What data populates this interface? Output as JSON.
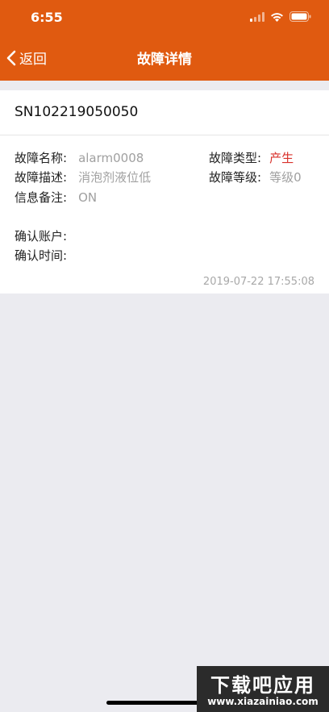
{
  "status_bar": {
    "time": "6:55"
  },
  "nav": {
    "back_label": "返回",
    "title": "故障详情"
  },
  "record": {
    "sn": "SN102219050050",
    "fault_name_label": "故障名称:",
    "fault_name_value": "alarm0008",
    "fault_type_label": "故障类型:",
    "fault_type_value": "产生",
    "fault_desc_label": "故障描述:",
    "fault_desc_value": "消泡剂液位低",
    "fault_level_label": "故障等级:",
    "fault_level_value": "等级0",
    "note_label": "信息备注:",
    "note_value": "ON",
    "confirm_account_label": "确认账户:",
    "confirm_time_label": "确认时间:",
    "timestamp": "2019-07-22 17:55:08"
  },
  "colors": {
    "header": "#e05a10",
    "accent_red": "#d9312b",
    "background": "#ebebf0"
  },
  "watermark": {
    "title": "下载吧应用",
    "url": "www.xiazainiao.com"
  }
}
